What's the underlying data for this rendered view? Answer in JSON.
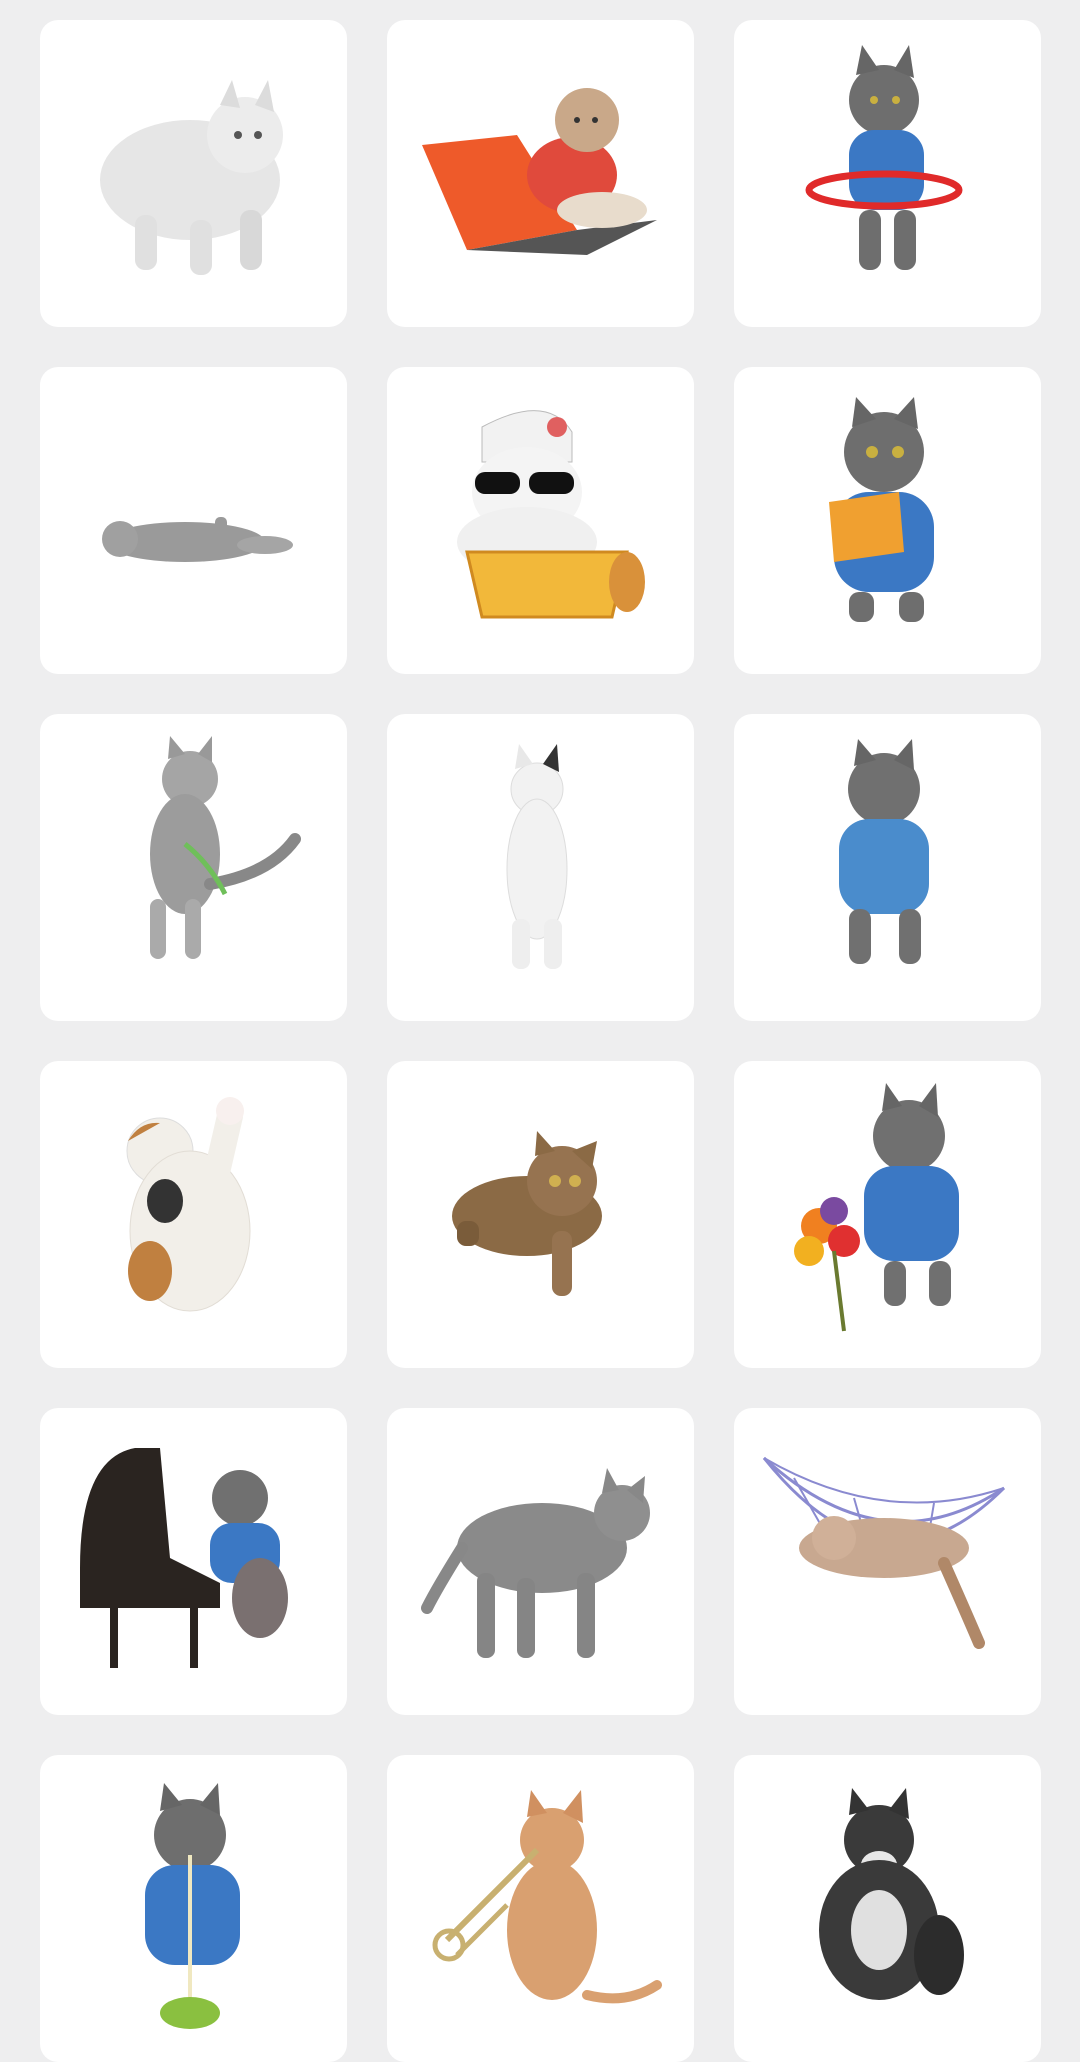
{
  "stickers": [
    {
      "id": 1,
      "icon": "white-fluffy-cat-icon",
      "colors": {
        "fur": "#e6e6e6"
      }
    },
    {
      "id": 2,
      "icon": "cat-with-laptop-icon",
      "colors": {
        "laptop": "#ee5a2a",
        "shirt": "#e04a3c"
      }
    },
    {
      "id": 3,
      "icon": "cat-hula-hoop-icon",
      "colors": {
        "fur": "#6e6e6e",
        "shirt": "#3b78c4",
        "hoop": "#e02a2a"
      }
    },
    {
      "id": 4,
      "icon": "cat-lying-down-icon",
      "colors": {
        "fur": "#9a9a9a"
      }
    },
    {
      "id": 5,
      "icon": "cat-sunglasses-basket-icon",
      "colors": {
        "basket": "#f2b83a",
        "glasses": "#111111"
      }
    },
    {
      "id": 6,
      "icon": "cat-reading-book-icon",
      "colors": {
        "fur": "#6e6e6e",
        "book": "#f0a030",
        "shirt": "#3b78c4"
      }
    },
    {
      "id": 7,
      "icon": "tabby-cat-standing-icon",
      "colors": {
        "fur": "#9c9c9c"
      }
    },
    {
      "id": 8,
      "icon": "white-cat-standing-icon",
      "colors": {
        "fur": "#f2f2f2"
      }
    },
    {
      "id": 9,
      "icon": "cat-blue-shirt-icon",
      "colors": {
        "fur": "#707070",
        "shirt": "#4a8ccc"
      }
    },
    {
      "id": 10,
      "icon": "calico-cat-waving-icon",
      "colors": {
        "fur": "#f2efe9",
        "patch": "#c08040"
      }
    },
    {
      "id": 11,
      "icon": "tabby-cat-leaping-icon",
      "colors": {
        "fur": "#8b6a45"
      }
    },
    {
      "id": 12,
      "icon": "cat-with-flowers-icon",
      "colors": {
        "fur": "#707070",
        "shirt": "#3b78c4"
      }
    },
    {
      "id": 13,
      "icon": "cat-playing-piano-icon",
      "colors": {
        "piano": "#2a2420",
        "shirt": "#3b78c4"
      }
    },
    {
      "id": 14,
      "icon": "gray-cat-walking-icon",
      "colors": {
        "fur": "#8a8a8a"
      }
    },
    {
      "id": 15,
      "icon": "cat-in-hammock-icon",
      "colors": {
        "net": "#8a8ad0",
        "fur": "#c8a890"
      }
    },
    {
      "id": 16,
      "icon": "cat-eating-noodles-icon",
      "colors": {
        "fur": "#6e6e6e",
        "shirt": "#3b78c4",
        "bowl": "#8ac040"
      }
    },
    {
      "id": 17,
      "icon": "cat-playing-trombone-icon",
      "colors": {
        "fur": "#d9a070",
        "horn": "#c8b070"
      }
    },
    {
      "id": 18,
      "icon": "black-white-cat-icon",
      "colors": {
        "fur": "#3a3a3a"
      }
    }
  ]
}
